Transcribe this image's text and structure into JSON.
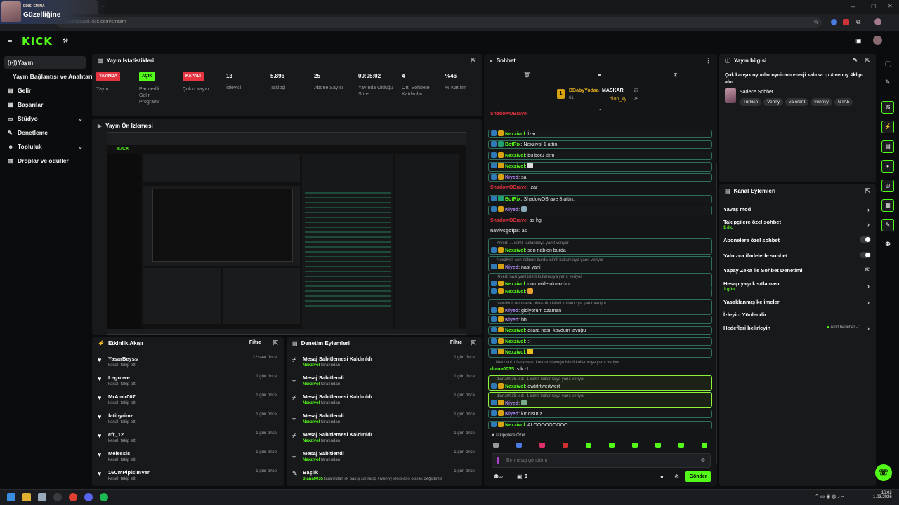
{
  "overlay": {
    "subtitle": "EDIS, EMINA",
    "title": "Güzelliğine"
  },
  "browser": {
    "url": "dashboard.kick.com/stream"
  },
  "header": {
    "logo": "KICK"
  },
  "sidebar": {
    "items": [
      {
        "label": "Yayın",
        "icon": "broadcast-icon"
      },
      {
        "label": "Yayın Bağlantısı ve Anahtarı",
        "icon": ""
      },
      {
        "label": "Gelir",
        "icon": "wallet-icon"
      },
      {
        "label": "Başarılar",
        "icon": "trophy-icon"
      },
      {
        "label": "Stüdyo",
        "icon": "studio-icon"
      },
      {
        "label": "Denetleme",
        "icon": "wrench-icon"
      },
      {
        "label": "Topluluk",
        "icon": "people-icon"
      },
      {
        "label": "Droplar ve ödüller",
        "icon": "gift-icon"
      }
    ]
  },
  "stats": {
    "title": "Yayın İstatistikleri",
    "items": [
      {
        "badge": "YAYINDA",
        "label": "Yayın"
      },
      {
        "badge": "AÇIK",
        "label": "Partnerlik Gelir Programı"
      },
      {
        "badge": "KAPALI",
        "label": "Çoklu Yayın"
      },
      {
        "value": "13",
        "label": "İzleyici"
      },
      {
        "value": "5.896",
        "label": "Takipçi"
      },
      {
        "value": "25",
        "label": "Abone Sayısı"
      },
      {
        "value": "00:05:02",
        "label": "Yayında Olduğu Süre"
      },
      {
        "value": "4",
        "label": "Ort. Sohbete Katılanlar"
      },
      {
        "value": "%46",
        "label": "% Katılım"
      }
    ]
  },
  "preview": {
    "title": "Yayın Ön İzlemesi"
  },
  "activity": {
    "title": "Etkinlik Akışı",
    "filter": "Filtre",
    "rows": [
      {
        "name": "YasarBeyss",
        "sub": "kanalı takip etti",
        "time": "22 saat önce"
      },
      {
        "name": "Legrowe",
        "sub": "kanalı takip etti",
        "time": "1 gün önce"
      },
      {
        "name": "MrAmir007",
        "sub": "kanalı takip etti",
        "time": "1 gün önce"
      },
      {
        "name": "fatihyrimz",
        "sub": "kanalı takip etti",
        "time": "1 gün önce"
      },
      {
        "name": "cfr_12",
        "sub": "kanalı takip etti",
        "time": "1 gün önce"
      },
      {
        "name": "Melessis",
        "sub": "kanalı takip etti",
        "time": "1 gün önce"
      },
      {
        "name": "16CmPipisimVar",
        "sub": "kanalı takip etti",
        "time": "1 gün önce"
      }
    ]
  },
  "moderation": {
    "title": "Denetim Eylemleri",
    "filter": "Filtre",
    "rows": [
      {
        "title": "Mesaj Sabitlemesi Kaldırıldı",
        "by": "Nexzivol",
        "suffix": "tarafından",
        "time": "1 gün önce"
      },
      {
        "title": "Mesaj Sabitlendi",
        "by": "Nexzivol",
        "suffix": "tarafından",
        "time": "1 gün önce"
      },
      {
        "title": "Mesaj Sabitlemesi Kaldırıldı",
        "by": "Nexzivol",
        "suffix": "tarafından",
        "time": "1 gün önce"
      },
      {
        "title": "Mesaj Sabitlendi",
        "by": "Nexzivol",
        "suffix": "tarafından",
        "time": "1 gün önce"
      },
      {
        "title": "Mesaj Sabitlemesi Kaldırıldı",
        "by": "Nexzivol",
        "suffix": "tarafından",
        "time": "1 gün önce"
      },
      {
        "title": "Mesaj Sabitlendi",
        "by": "Nexzivol",
        "suffix": "tarafından",
        "time": "1 gün önce"
      },
      {
        "title": "Başlık",
        "by": "diana0035",
        "suffix": "tarafından ilk bakış sonra rp #ivenny #klip-alın olarak değiştirildi",
        "time": "1 gün önce"
      }
    ]
  },
  "chat": {
    "title": "Sohbet",
    "leaderboard": {
      "left": "BBabyYodaa",
      "left_count": "61",
      "right1": "MASKAR",
      "right1_count": "27",
      "right2": "dion_ky",
      "right2_count": "25"
    },
    "messages": [
      {
        "user": "ShadowOBrave",
        "text": "",
        "type": "plain",
        "cls": "sh"
      },
      {
        "user": "Nexzivol",
        "text": "İzar",
        "cls": "nx"
      },
      {
        "user": "BotRix",
        "text": "Nexzivol 1 attın.",
        "cls": "bot"
      },
      {
        "user": "Nexzivol",
        "text": "bu botu skm",
        "cls": "nx"
      },
      {
        "user": "Nexzivol",
        "text": "",
        "cls": "nx"
      },
      {
        "user": "Kiyed",
        "text": "sa",
        "cls": "ky"
      },
      {
        "user": "ShadowOBrave",
        "text": "İzar",
        "type": "plain",
        "cls": "sh"
      },
      {
        "user": "BotRix",
        "text": "ShadowOBrave 3 attın.",
        "cls": "bot"
      },
      {
        "user": "Kiyed",
        "text": "",
        "cls": "ky"
      },
      {
        "user": "ShadowOBrave",
        "text": "as hg",
        "type": "plain",
        "cls": "sh"
      },
      {
        "user": "navivcgofps",
        "text": "as",
        "type": "plain",
        "cls": "muted"
      },
      {
        "user": "Nexzivol",
        "text": "sen nabıon burda",
        "cls": "nx",
        "reply": "Kiyed: ... isimli kullanıcıya yanıt veriyor"
      },
      {
        "user": "Kiyed",
        "text": "nasi yani",
        "cls": "ky",
        "reply": "Nexzivol: sen nabıon burda isimli kullanıcıya yanıt veriyor"
      },
      {
        "user": "Nexzivol",
        "text": "normalde olmazdın",
        "cls": "nx",
        "reply": "Kiyed: nasi yani isimli kullanıcıya yanıt veriyor"
      },
      {
        "user": "Nexzivol",
        "text": "",
        "cls": "nx"
      },
      {
        "user": "Kiyed",
        "text": "gidiyorum ozaman",
        "cls": "ky",
        "reply": "Nexzivol: normalde olmazdın isimli kullanıcıya yanıt veriyor"
      },
      {
        "user": "Kiyed",
        "text": "bb",
        "cls": "ky"
      },
      {
        "user": "Nexzivol",
        "text": "dilara nasıl kovdum lavuğu",
        "cls": "nx"
      },
      {
        "user": "Nexzivol",
        "text": ":)",
        "cls": "nx"
      },
      {
        "user": "Nexzivol",
        "text": "",
        "cls": "nx"
      },
      {
        "user": "diana0035",
        "text": "sık -1",
        "type": "plain",
        "cls": "di",
        "reply": "Nexzivol: dilara nasıl kovdum lavuğu isimli kullanıcıya yanıt veriyor"
      },
      {
        "user": "Nexzivol",
        "text": "ewtrtrtwertwert",
        "cls": "nx",
        "type": "hl",
        "reply": "diana0035: sık -1 isimli kullanıcıya yanıt veriyor"
      },
      {
        "user": "Kiyed",
        "text": "",
        "cls": "ky",
        "type": "hl",
        "reply": "diana0035: sık -1 isimli kullanıcıya yanıt veriyor"
      },
      {
        "user": "Kiyed",
        "text": "kırıcısınız",
        "cls": "ky"
      },
      {
        "user": "Nexzivol",
        "text": "ALOOOOOOOOO",
        "cls": "nx"
      }
    ],
    "followers_only": "Takipçilere Özel",
    "input_placeholder": "Bir mesaj gönderin",
    "send": "Gönder",
    "count": "0"
  },
  "info": {
    "title": "Yayın bilgisi",
    "stream_title": "Çok karışık oyunlar oynicam enerji kalırsa rp #ivenny #klip-alın",
    "category": "Sadece Sohbet",
    "tags": [
      "Turkish",
      "Venny",
      "valorant",
      "vennyy",
      "GTA5"
    ]
  },
  "actions": {
    "title": "Kanal Eylemleri",
    "items": [
      {
        "label": "Yavaş mod",
        "sub": "",
        "ctl": "arrow"
      },
      {
        "label": "Takipçilere özel sohbet",
        "sub": "1 dk.",
        "ctl": "arrow"
      },
      {
        "label": "Abonelere özel sohbet",
        "sub": "",
        "ctl": "toggle"
      },
      {
        "label": "Yalnızca ifadelerle sohbet",
        "sub": "",
        "ctl": "toggle"
      },
      {
        "label": "Yapay Zeka ile Sohbet Denetimi",
        "sub": "",
        "ctl": "ext"
      },
      {
        "label": "Hesap yaşı kısıtlaması",
        "sub": "1 gün",
        "ctl": "arrow"
      },
      {
        "label": "Yasaklanmış kelimeler",
        "sub": "",
        "ctl": "arrow"
      },
      {
        "label": "İzleyici Yönlendir",
        "sub": "",
        "ctl": "none"
      },
      {
        "label": "Hedefleri belirleyin",
        "sub": "",
        "ctl": "arrow",
        "note": "Aktif hedefler - 1"
      }
    ]
  },
  "taskbar": {
    "time": "16:02",
    "date": "1.03.2026"
  }
}
